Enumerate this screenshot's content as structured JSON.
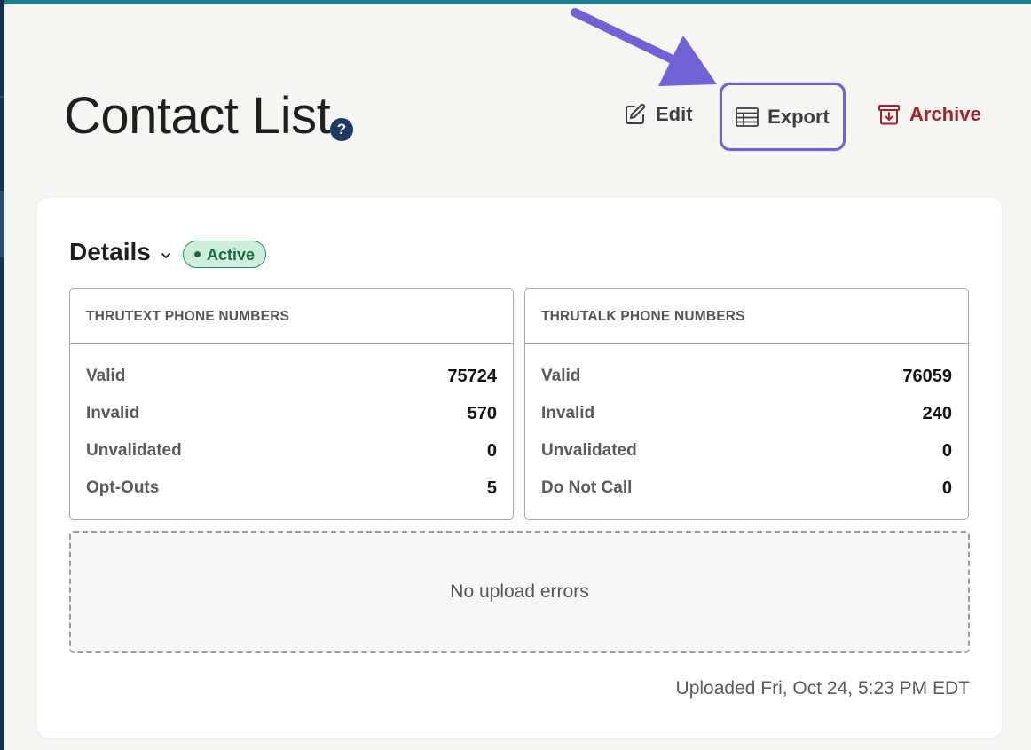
{
  "header": {
    "title": "Contact List",
    "help_glyph": "?"
  },
  "actions": {
    "edit_label": "Edit",
    "export_label": "Export",
    "archive_label": "Archive"
  },
  "details": {
    "title": "Details",
    "status_badge": "Active"
  },
  "panels": [
    {
      "header": "THRUTEXT PHONE NUMBERS",
      "rows": [
        {
          "label": "Valid",
          "value": "75724"
        },
        {
          "label": "Invalid",
          "value": "570"
        },
        {
          "label": "Unvalidated",
          "value": "0"
        },
        {
          "label": "Opt-Outs",
          "value": "5"
        }
      ]
    },
    {
      "header": "THRUTALK PHONE NUMBERS",
      "rows": [
        {
          "label": "Valid",
          "value": "76059"
        },
        {
          "label": "Invalid",
          "value": "240"
        },
        {
          "label": "Unvalidated",
          "value": "0"
        },
        {
          "label": "Do Not Call",
          "value": "0"
        }
      ]
    }
  ],
  "upload_errors": "No upload errors",
  "uploaded_text": "Uploaded Fri, Oct 24, 5:23 PM EDT",
  "colors": {
    "accent_highlight": "#6f62d5",
    "archive_red": "#a3232a",
    "badge_green": "#1c6b3c",
    "badge_bg": "#cdeedb"
  },
  "icons": {
    "edit": "pencil-square-icon",
    "export": "table-icon",
    "archive": "archive-box-icon",
    "help": "question-circle-icon",
    "chevron": "chevron-down-icon",
    "annotation": "arrow-annotation"
  }
}
